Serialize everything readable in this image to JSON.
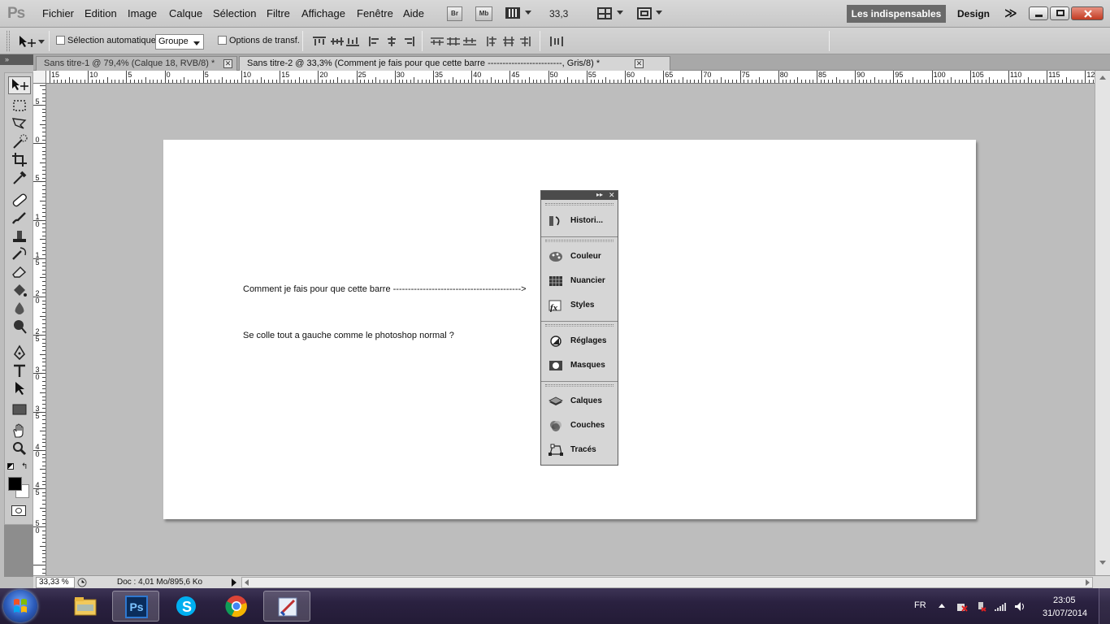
{
  "app": {
    "logo": "Ps"
  },
  "menubar": {
    "items": [
      "Fichier",
      "Edition",
      "Image",
      "Calque",
      "Sélection",
      "Filtre",
      "Affichage",
      "Fenêtre",
      "Aide"
    ],
    "bridge_label": "Br",
    "minibridge_label": "Mb",
    "zoom": "33,3",
    "workspace_active": "Les indispensables",
    "workspace_other": "Design",
    "workspace_more": "≫"
  },
  "options": {
    "auto_select_label": "Sélection automatique :",
    "auto_select_value": "Groupe",
    "transform_label": "Options de transf."
  },
  "tabs": [
    {
      "label": "Sans titre-1 @ 79,4% (Calque 18, RVB/8) *"
    },
    {
      "label": "Sans titre-2 @ 33,3% (Comment je fais pour que cette barre -------------------------, Gris/8) *"
    }
  ],
  "toolbar_head": "»",
  "ruler": {
    "h_labels": [
      "15",
      "10",
      "5",
      "0",
      "5",
      "10",
      "15",
      "20",
      "25",
      "30",
      "35",
      "40",
      "45",
      "50",
      "55",
      "60",
      "65",
      "70",
      "75",
      "80",
      "85",
      "90",
      "95",
      "100",
      "105",
      "110",
      "115",
      "12"
    ],
    "v_labels": [
      "5",
      "0",
      "5",
      "10",
      "15",
      "20",
      "25",
      "30",
      "35",
      "40",
      "45",
      "50"
    ]
  },
  "document": {
    "line1": "Comment je fais pour que cette barre ------------------------------------------->",
    "line2": "Se colle tout a gauche comme le photoshop normal ?"
  },
  "panel": {
    "collapse": "▸▸",
    "close": "✕",
    "items": [
      {
        "label": "Histori...",
        "icon": "history-icon"
      },
      {
        "label": "Couleur",
        "icon": "color-icon"
      },
      {
        "label": "Nuancier",
        "icon": "swatches-icon"
      },
      {
        "label": "Styles",
        "icon": "styles-icon"
      },
      {
        "label": "Réglages",
        "icon": "adjustments-icon"
      },
      {
        "label": "Masques",
        "icon": "masks-icon"
      },
      {
        "label": "Calques",
        "icon": "layers-icon"
      },
      {
        "label": "Couches",
        "icon": "channels-icon"
      },
      {
        "label": "Tracés",
        "icon": "paths-icon"
      }
    ]
  },
  "status": {
    "zoom": "33,33 %",
    "doc": "Doc : 4,01 Mo/895,6 Ko"
  },
  "taskbar": {
    "lang": "FR",
    "time": "23:05",
    "date": "31/07/2014",
    "ps_label": "Ps"
  },
  "colors": {
    "accent_ps": "#1f5fb0",
    "workspace_active_bg": "#6a6a6a",
    "taskbar": "#2a2140"
  }
}
